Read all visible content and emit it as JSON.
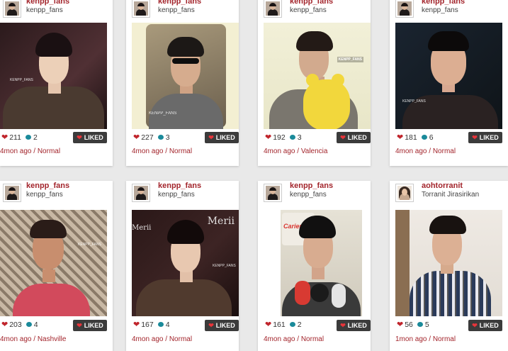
{
  "liked_label": "LIKED",
  "separator": " / ",
  "posts": [
    {
      "username": "kenpp_fans",
      "fullname": "kenpp_fans",
      "likes": "211",
      "comments": "2",
      "time": "4mon ago",
      "location": "Normal"
    },
    {
      "username": "kenpp_fans",
      "fullname": "kenpp_fans",
      "likes": "227",
      "comments": "3",
      "time": "4mon ago",
      "location": "Normal"
    },
    {
      "username": "kenpp_fans",
      "fullname": "kenpp_fans",
      "likes": "192",
      "comments": "3",
      "time": "4mon ago",
      "location": "Valencia"
    },
    {
      "username": "kenpp_fans",
      "fullname": "kenpp_fans",
      "likes": "181",
      "comments": "6",
      "time": "4mon ago",
      "location": "Normal"
    },
    {
      "username": "kenpp_fans",
      "fullname": "kenpp_fans",
      "likes": "203",
      "comments": "4",
      "time": "4mon ago",
      "location": "Nashville"
    },
    {
      "username": "kenpp_fans",
      "fullname": "kenpp_fans",
      "likes": "167",
      "comments": "4",
      "time": "4mon ago",
      "location": "Normal"
    },
    {
      "username": "kenpp_fans",
      "fullname": "kenpp_fans",
      "likes": "161",
      "comments": "2",
      "time": "4mon ago",
      "location": "Normal"
    },
    {
      "username": "aohtorranit",
      "fullname": "Torranit Jirasirikan",
      "likes": "56",
      "comments": "5",
      "time": "1mon ago",
      "location": "Normal"
    }
  ],
  "photo_overlays": {
    "merii": "Merii",
    "watermark": "KENPP_FANS",
    "plaque": "Cariens",
    "kfans": "KENPP_FANS"
  },
  "icons": {
    "like": "heart-icon",
    "comment": "comment-bubble-icon",
    "avatar": "avatar"
  },
  "colors": {
    "username": "#a3252c",
    "liked_button": "#3b3b3b",
    "heart": "#c0252c",
    "comment": "#1a8a9a",
    "background": "#e9e9e9"
  }
}
